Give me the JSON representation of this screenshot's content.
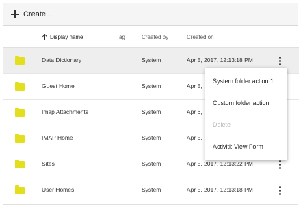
{
  "toolbar": {
    "create_label": "Create..."
  },
  "columns": {
    "display_name": "Display name",
    "tag": "Tag",
    "created_by": "Created by",
    "created_on": "Created on"
  },
  "rows": [
    {
      "name": "Data Dictionary",
      "created_by": "System",
      "created_on": "Apr 5, 2017, 12:13:18 PM"
    },
    {
      "name": "Guest Home",
      "created_by": "System",
      "created_on": "Apr 5,"
    },
    {
      "name": "Imap Attachments",
      "created_by": "System",
      "created_on": "Apr 6,"
    },
    {
      "name": "IMAP Home",
      "created_by": "System",
      "created_on": "Apr 5,"
    },
    {
      "name": "Sites",
      "created_by": "System",
      "created_on": "Apr 5, 2017, 12:13:22 PM"
    },
    {
      "name": "User Homes",
      "created_by": "System",
      "created_on": "Apr 5, 2017, 12:13:18 PM"
    }
  ],
  "context_menu": {
    "items": [
      {
        "label": "System folder action 1",
        "enabled": true
      },
      {
        "label": "Custom folder action",
        "enabled": true
      },
      {
        "label": "Delete",
        "enabled": false
      },
      {
        "label": "Activiti: View Form",
        "enabled": true
      }
    ]
  },
  "colors": {
    "folder": "#e3df1e",
    "hover_row": "#eeeeee",
    "disabled_text": "#b8b8b8"
  }
}
